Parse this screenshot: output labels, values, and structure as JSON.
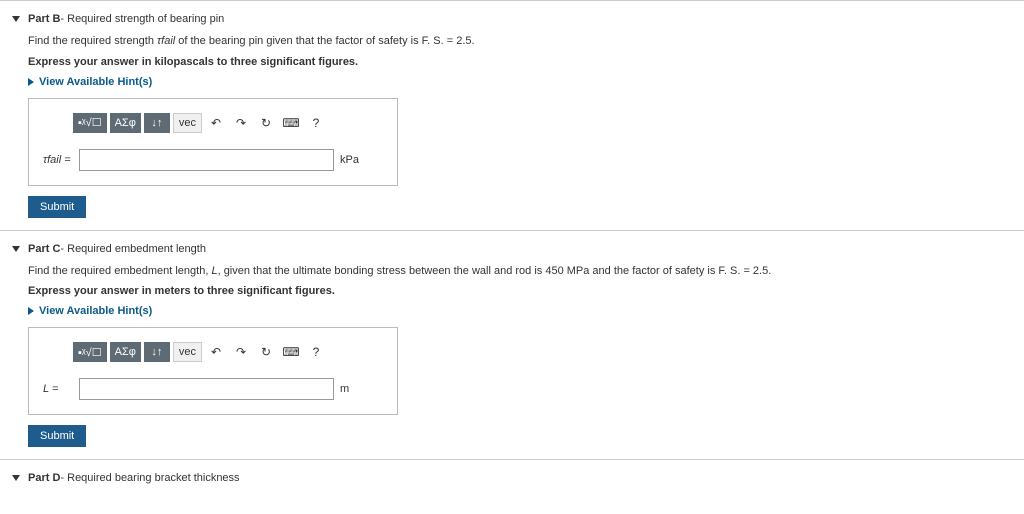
{
  "partB": {
    "label": "Part B",
    "title": " - Required strength of bearing pin",
    "question_pre": "Find the required strength ",
    "question_var": "τfail",
    "question_mid": " of the bearing pin given that the factor of safety is ",
    "question_fs": "F. S. = 2.5",
    "question_end": ".",
    "instruct": "Express your answer in kilopascals to three significant figures.",
    "hints": "View Available Hint(s)",
    "toolbar": {
      "greek": "ΑΣφ",
      "arrows": "↓↑",
      "vec": "vec",
      "help": "?"
    },
    "varlabel": "τfail =",
    "unit": "kPa",
    "submit": "Submit"
  },
  "partC": {
    "label": "Part C",
    "title": " - Required embedment length",
    "question_pre": "Find the required embedment length, ",
    "question_var": "L",
    "question_mid": ", given that the ultimate bonding stress between the wall and rod is 450 ",
    "question_mpa": "MPa",
    "question_mid2": " and the factor of safety is ",
    "question_fs": "F. S. = 2.5",
    "question_end": ".",
    "instruct": "Express your answer in meters to three significant figures.",
    "hints": "View Available Hint(s)",
    "toolbar": {
      "greek": "ΑΣφ",
      "arrows": "↓↑",
      "vec": "vec",
      "help": "?"
    },
    "varlabel": "L =",
    "unit": "m",
    "submit": "Submit"
  },
  "partD": {
    "label": "Part D",
    "title": " - Required bearing bracket thickness"
  }
}
